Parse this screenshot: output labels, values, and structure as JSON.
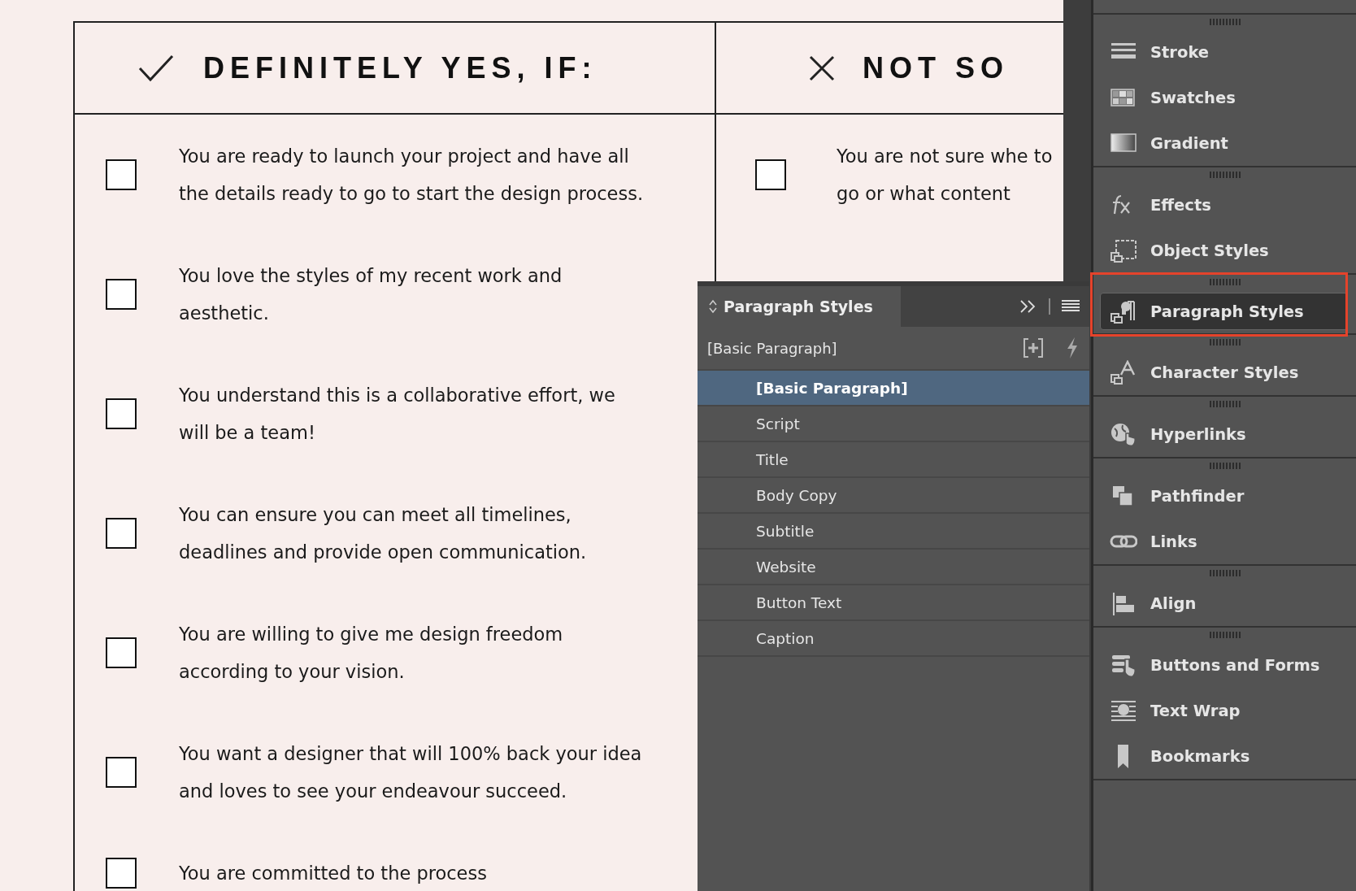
{
  "document": {
    "columns": [
      {
        "kind": "yes",
        "heading": "DEFINITELY YES, IF:",
        "items": [
          "You are ready to launch your project and have all the details ready to go to start the design process.",
          "You love the styles of my recent work and aesthetic.",
          "You understand this is a collaborative effort, we will be a team!",
          "You can ensure you can meet all timelines, deadlines and provide open communication.",
          "You are willing to give me design freedom according to your vision.",
          "You want a designer that will 100% back your idea and loves to see your endeavour succeed.",
          "You are committed to the process"
        ]
      },
      {
        "kind": "no",
        "heading": "NOT SO",
        "items": [
          "You are not sure whe to go or what content"
        ]
      }
    ]
  },
  "styles_panel": {
    "title": "Paragraph Styles",
    "current_style": "[Basic Paragraph]",
    "styles": [
      {
        "label": "[Basic Paragraph]",
        "selected": true
      },
      {
        "label": "Script",
        "selected": false
      },
      {
        "label": "Title",
        "selected": false
      },
      {
        "label": "Body Copy",
        "selected": false
      },
      {
        "label": "Subtitle",
        "selected": false
      },
      {
        "label": "Website",
        "selected": false
      },
      {
        "label": "Button Text",
        "selected": false
      },
      {
        "label": "Caption",
        "selected": false
      }
    ]
  },
  "dock": {
    "groups": [
      {
        "highlighted": false,
        "items": [
          {
            "kind": "stroke",
            "label": "Stroke",
            "selected": false
          },
          {
            "kind": "swatches",
            "label": "Swatches",
            "selected": false
          },
          {
            "kind": "gradient",
            "label": "Gradient",
            "selected": false
          }
        ]
      },
      {
        "highlighted": false,
        "items": [
          {
            "kind": "effects",
            "label": "Effects",
            "selected": false
          },
          {
            "kind": "object-styles",
            "label": "Object Styles",
            "selected": false
          }
        ]
      },
      {
        "highlighted": true,
        "items": [
          {
            "kind": "paragraph-styles",
            "label": "Paragraph Styles",
            "selected": true
          }
        ]
      },
      {
        "highlighted": false,
        "items": [
          {
            "kind": "character-styles",
            "label": "Character Styles",
            "selected": false
          }
        ]
      },
      {
        "highlighted": false,
        "items": [
          {
            "kind": "hyperlinks",
            "label": "Hyperlinks",
            "selected": false
          }
        ]
      },
      {
        "highlighted": false,
        "items": [
          {
            "kind": "pathfinder",
            "label": "Pathfinder",
            "selected": false
          },
          {
            "kind": "links",
            "label": "Links",
            "selected": false
          }
        ]
      },
      {
        "highlighted": false,
        "items": [
          {
            "kind": "align",
            "label": "Align",
            "selected": false
          }
        ]
      },
      {
        "highlighted": false,
        "items": [
          {
            "kind": "buttons",
            "label": "Buttons and Forms",
            "selected": false
          },
          {
            "kind": "text-wrap",
            "label": "Text Wrap",
            "selected": false
          },
          {
            "kind": "bookmarks",
            "label": "Bookmarks",
            "selected": false
          }
        ]
      }
    ]
  }
}
